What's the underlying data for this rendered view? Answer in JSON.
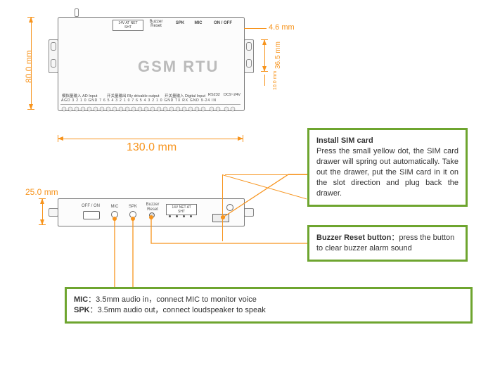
{
  "device_name": "GSM RTU",
  "dimensions": {
    "width_mm": "130.0 mm",
    "height_mm": "80.0 mm",
    "bracket_clearance_mm": "4.6 mm",
    "bracket_height_mm": "36.5 mm",
    "bracket_small_mm": "10.0 mm",
    "front_height_mm": "25.0 mm"
  },
  "top_labels": {
    "power_block": "14V  AT  NET  SHT",
    "buzzer": "Buzzer Reset",
    "spk": "SPK",
    "mic": "MIC",
    "onoff": "ON / OFF"
  },
  "bottom_strip": {
    "ad_title_cn": "模拟量输入 AD Input",
    "relay_title_cn": "开关量输出 Rly drivable output",
    "di_title_cn": "开关量输入    Digital Input",
    "rs232": "RS232",
    "power": "DC9~24V",
    "ad_labels": "AGD 3  2  1  0  GND 7  6  5  4  3  2  1  0      7  6  5  4  3  2  1  0      GND TX RX  GND 9-24 IN"
  },
  "front_labels": {
    "onoff": "OFF / ON",
    "mic": "MIC",
    "spk": "SPK",
    "buzzer": "Buzzer Reset",
    "leds": "14V NET AT SHT"
  },
  "callouts": {
    "sim": {
      "title": "Install SIM card",
      "body": "Press the small yellow dot, the SIM card drawer will spring out automatically. Take out the drawer, put the SIM card in it on the slot direction and plug back the drawer."
    },
    "buzzer": {
      "title": "Buzzer Reset button",
      "body": "：press the button to clear buzzer alarm sound"
    },
    "audio": {
      "mic_title": "MIC",
      "mic_body": "：3.5mm audio in，connect MIC to monitor voice",
      "spk_title": "SPK",
      "spk_body": "：3.5mm audio out，connect loudspeaker to speak"
    }
  }
}
